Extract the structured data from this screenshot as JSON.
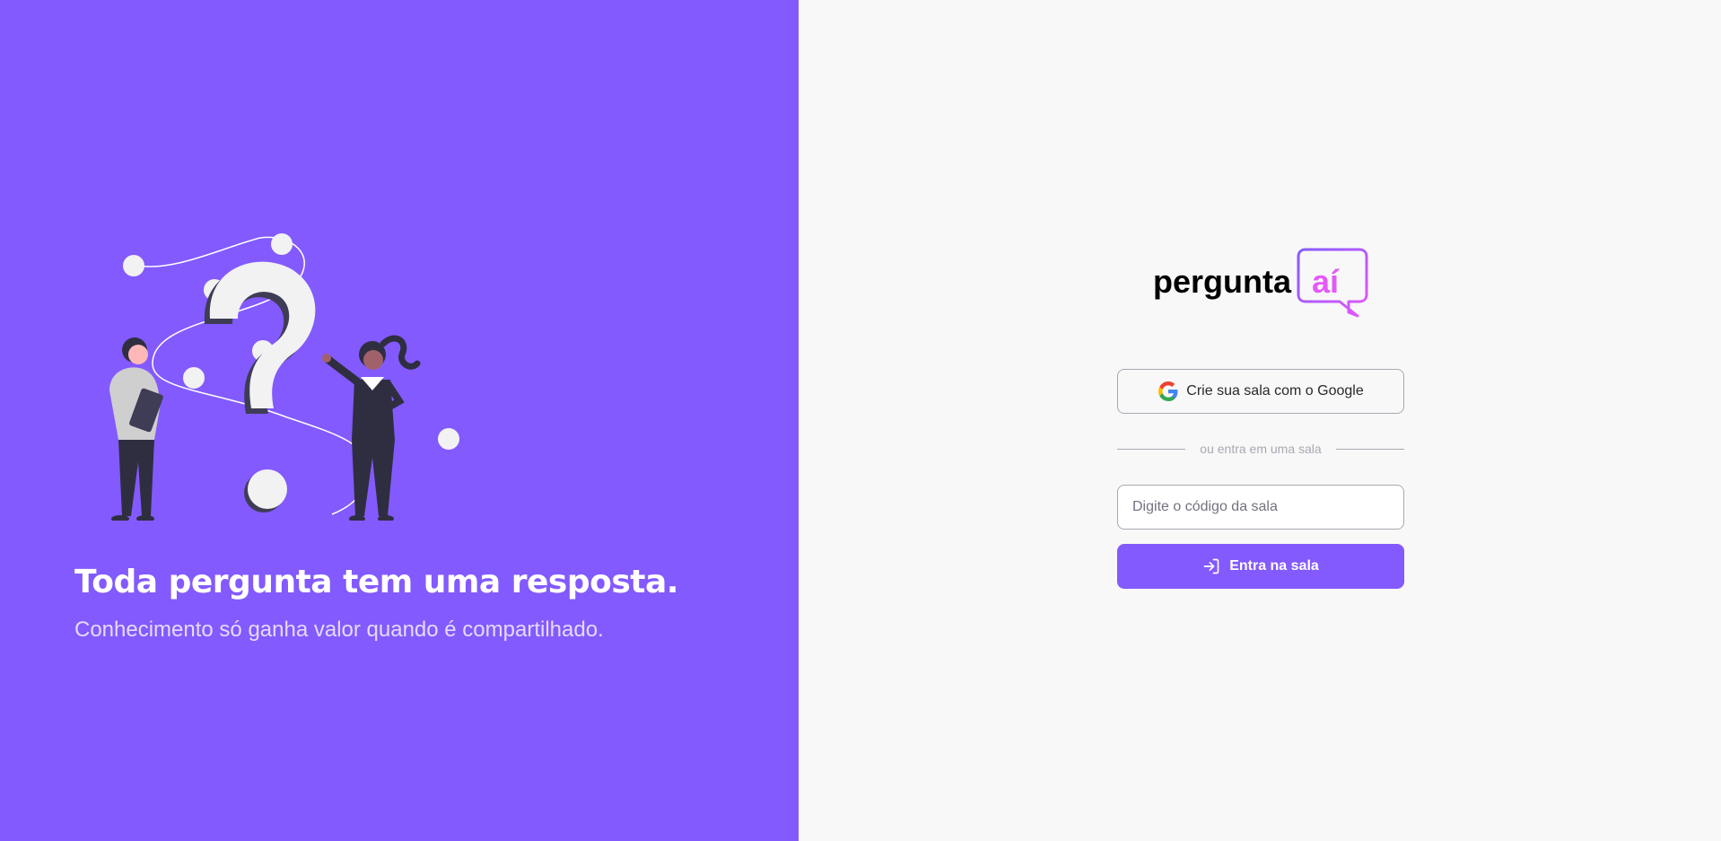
{
  "aside": {
    "illustration_icon": "question-mark-people-illustration",
    "headline": "Toda pergunta tem uma resposta.",
    "subline": "Conhecimento só ganha valor quando é compartilhado."
  },
  "logo": {
    "word": "pergunta",
    "accent": "aí"
  },
  "google_button": {
    "icon": "google-icon",
    "label": "Crie sua sala com o Google"
  },
  "separator_text": "ou entra em uma sala",
  "room_input": {
    "placeholder": "Digite o código da sala",
    "value": ""
  },
  "enter_button": {
    "icon": "log-in-icon",
    "label": "Entra na sala"
  },
  "colors": {
    "brand": "#835afd",
    "accent": "#e559f9",
    "background": "#f8f8f8"
  }
}
